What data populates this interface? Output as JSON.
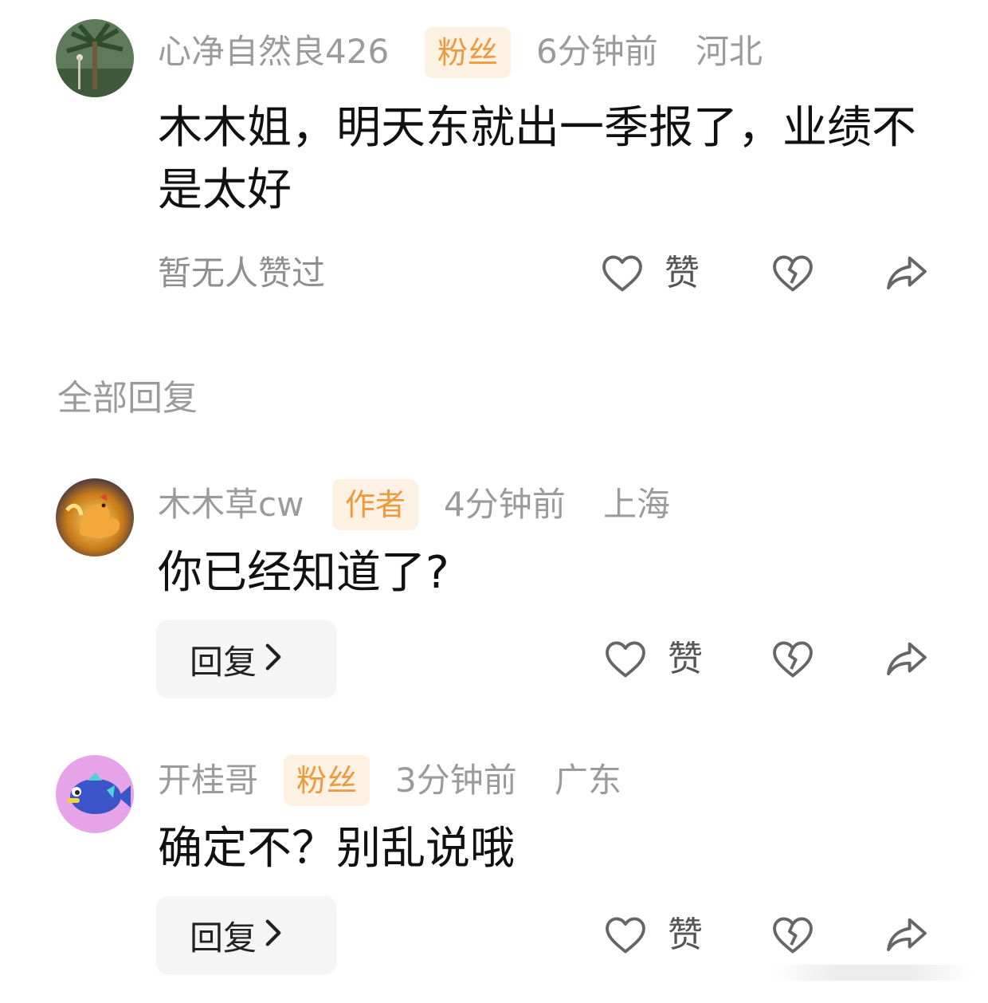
{
  "main_comment": {
    "username": "心净自然良426",
    "badge": "粉丝",
    "time": "6分钟前",
    "location": "河北",
    "content": "木木姐，明天东就出一季报了，业绩不是太好",
    "like_status": "暂无人赞过",
    "like_label": "赞"
  },
  "replies_header": "全部回复",
  "replies": [
    {
      "username": "木木草cw",
      "badge": "作者",
      "time": "4分钟前",
      "location": "上海",
      "content": "你已经知道了?",
      "reply_label": "回复",
      "like_label": "赞"
    },
    {
      "username": "开桂哥",
      "badge": "粉丝",
      "time": "3分钟前",
      "location": "广东",
      "content": "确定不？别乱说哦",
      "reply_label": "回复",
      "like_label": "赞"
    }
  ],
  "colors": {
    "badge_bg": "#fdf1e3",
    "badge_text": "#ec9a3c",
    "meta_text": "#9b9b9b",
    "icon_stroke": "#666666"
  },
  "icons": [
    "heart-outline-icon",
    "broken-heart-icon",
    "share-forward-icon",
    "chevron-right-icon"
  ]
}
